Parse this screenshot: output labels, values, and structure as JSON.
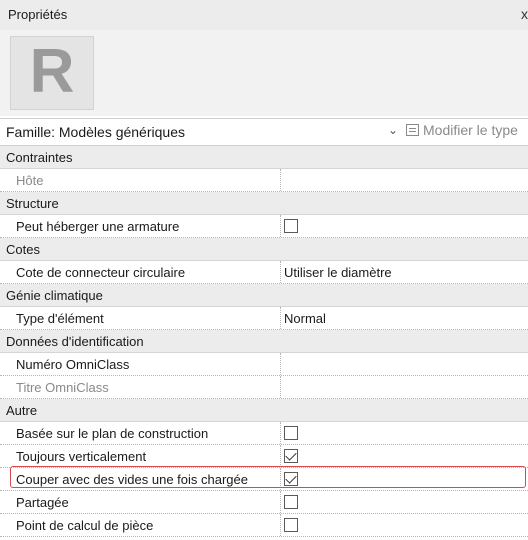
{
  "panel": {
    "title": "Propriétés",
    "close_glyph": "x",
    "logo_letter": "R"
  },
  "type_selector": {
    "family": "Famille: Modèles génériques",
    "edit_type": "Modifier le type"
  },
  "groups": {
    "contraintes": "Contraintes",
    "structure": "Structure",
    "cotes": "Cotes",
    "genie": "Génie climatique",
    "identification": "Données d'identification",
    "autre": "Autre"
  },
  "rows": {
    "hote": {
      "label": "Hôte",
      "value": ""
    },
    "armature": {
      "label": "Peut héberger une armature",
      "checked": false
    },
    "connecteur": {
      "label": "Cote de connecteur circulaire",
      "value": "Utiliser le diamètre"
    },
    "type_element": {
      "label": "Type d'élément",
      "value": "Normal"
    },
    "omniclass_num": {
      "label": "Numéro OmniClass",
      "value": ""
    },
    "omniclass_titre": {
      "label": "Titre OmniClass",
      "value": ""
    },
    "basee_plan": {
      "label": "Basée sur le plan de construction",
      "checked": false
    },
    "toujours_vert": {
      "label": "Toujours verticalement",
      "checked": true
    },
    "couper_vides": {
      "label": "Couper avec des vides une fois chargée",
      "checked": true,
      "highlighted": true
    },
    "partagee": {
      "label": "Partagée",
      "checked": false
    },
    "point_calcul": {
      "label": "Point de calcul de pièce",
      "checked": false
    }
  },
  "highlight_color": "#d8494c"
}
